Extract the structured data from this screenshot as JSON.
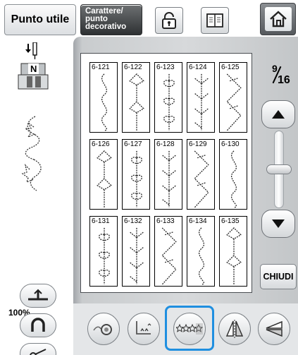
{
  "top_bar": {
    "utility_label": "Punto utile",
    "decorative_label_line1": "Carattere/",
    "decorative_label_line2": "punto",
    "decorative_label_line3": "decorativo",
    "icons": [
      "lock-icon",
      "book-icon",
      "home-icon"
    ]
  },
  "left_panel": {
    "presser_foot_label": "N",
    "zoom_percent": "100%"
  },
  "patterns": [
    {
      "id": "6-121"
    },
    {
      "id": "6-122"
    },
    {
      "id": "6-123"
    },
    {
      "id": "6-124"
    },
    {
      "id": "6-125"
    },
    {
      "id": "6-126"
    },
    {
      "id": "6-127"
    },
    {
      "id": "6-128"
    },
    {
      "id": "6-129"
    },
    {
      "id": "6-130"
    },
    {
      "id": "6-131"
    },
    {
      "id": "6-132"
    },
    {
      "id": "6-133"
    },
    {
      "id": "6-134"
    },
    {
      "id": "6-135"
    }
  ],
  "page_indicator": {
    "current": "9",
    "total": "16"
  },
  "buttons": {
    "close_label": "CHIUDI"
  },
  "colors": {
    "selection_accent": "#1f8fe0",
    "decorative_tab_bg": "#3f4244"
  }
}
